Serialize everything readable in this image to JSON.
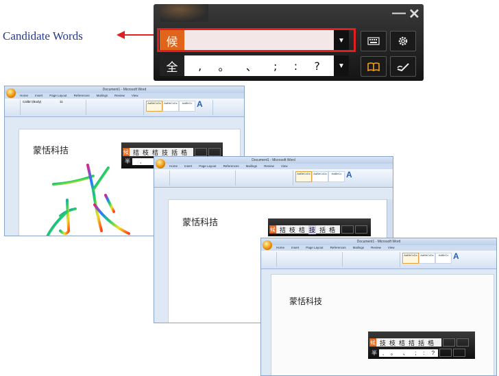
{
  "callout": {
    "label": "Candidate Words"
  },
  "ime": {
    "minimize": "—",
    "close": "✕",
    "mode_char": "候",
    "full_char": "全",
    "dropdown": "▼",
    "punctuation": [
      ",",
      "。",
      "、",
      ";",
      ":",
      "?"
    ],
    "icons": [
      "keyboard-icon",
      "settings-gear-icon",
      "book-icon",
      "handwriting-pen-icon"
    ]
  },
  "windows": [
    {
      "title": "Document1 - Microsoft Word",
      "tabs": [
        "Home",
        "Insert",
        "Page Layout",
        "References",
        "Mailings",
        "Review",
        "View"
      ],
      "font_name": "Calibri (Body)",
      "font_size": "11",
      "styles": [
        "AaBbCcDc",
        "AaBbCcDc",
        "AaBbCc"
      ],
      "style_names": [
        "¶ Normal",
        "¶ No Spaci...",
        "Heading 1"
      ],
      "groups": [
        "Clipboard",
        "Font",
        "Paragraph",
        "Styles",
        "Editing"
      ],
      "doc_text": "蒙恬科拮",
      "mini_candidates": [
        "拮",
        "枝",
        "桔",
        "技",
        "括",
        "梏"
      ],
      "mini_punct": [
        ",",
        "。",
        "、",
        ";",
        ":",
        "?"
      ],
      "mini_mode": "候",
      "mini_full": "半"
    },
    {
      "title": "Document1 - Microsoft Word",
      "doc_text": "蒙恬科拮",
      "mini_candidates": [
        "拮",
        "枝",
        "桔",
        "技",
        "括",
        "梏"
      ]
    },
    {
      "title": "Document1 - Microsoft Word",
      "doc_text": "蒙恬科技",
      "mini_candidates": [
        "技",
        "枝",
        "桔",
        "拮",
        "括",
        "梏"
      ],
      "mini_punct": [
        ",",
        "。",
        "、",
        ";",
        ":",
        "?"
      ],
      "mini_full": "半"
    }
  ],
  "colors": {
    "highlight": "#e21e1e",
    "label": "#253a8a",
    "ime_orange": "#e0641a"
  }
}
